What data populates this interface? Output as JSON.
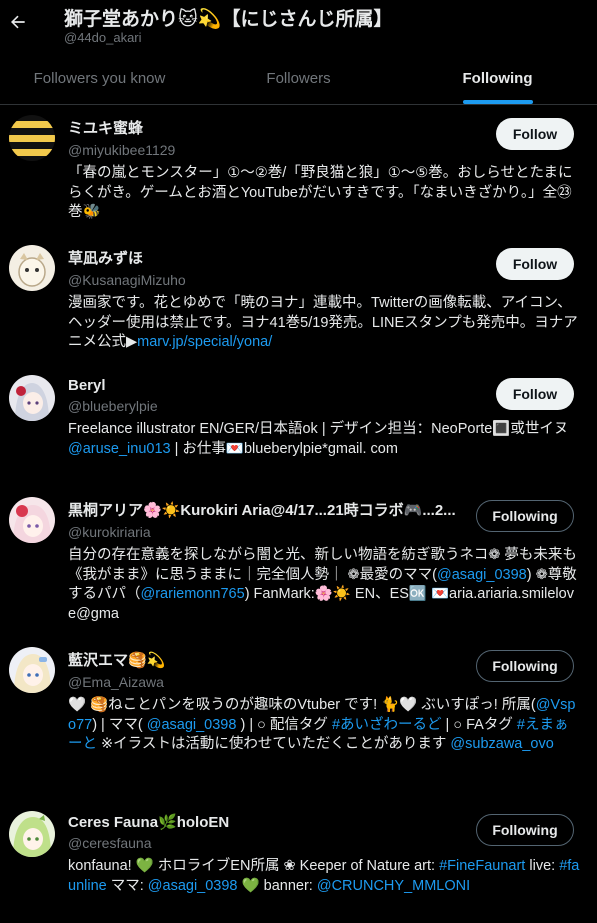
{
  "header": {
    "title": "獅子堂あかり🐱💫【にじさんじ所属】",
    "handle": "@44do_akari",
    "back_icon": "arrow-left-icon"
  },
  "tabs": [
    {
      "label": "Followers you know"
    },
    {
      "label": "Followers"
    },
    {
      "label": "Following",
      "active": true
    }
  ],
  "accent_color": "#1d9bf0",
  "users": [
    {
      "name": "ミユキ蜜蜂",
      "handle": "@miyukibee1129",
      "button": "Follow",
      "bio": "「春の嵐とモンスター」①〜②巻/「野良猫と狼」①〜⑤巻。おしらせとたまにらくがき。ゲームとお酒とYouTubeがだいすきです。「なまいきざかり。」全㉓巻🐝"
    },
    {
      "name": "草凪みずほ",
      "handle": "@KusanagiMizuho",
      "button": "Follow",
      "bio_parts": [
        "漫画家です。花とゆめで「暁のヨナ」連載中。Twitterの画像転載、アイコン、ヘッダー使用は禁止です。ヨナ41巻5/19発売。LINEスタンプも発売中。ヨナアニメ公式▶",
        "marv.jp/special/yona/"
      ]
    },
    {
      "name": "Beryl",
      "handle": "@blueberylpie",
      "button": "Follow",
      "bio_parts": [
        "Freelance illustrator EN/GER/日本語ok | デザイン担当：NeoPorte🔳或世イヌ ",
        "@aruse_inu013",
        " | お仕事💌blueberylpie*gmail. com"
      ]
    },
    {
      "name": "黒桐アリア🌸☀️Kurokiri Aria@4/17...21時コラボ🎮...2...",
      "handle": "@kurokiriaria",
      "button": "Following",
      "bio_parts": [
        "自分の存在意義を探しながら闇と光、新しい物語を紡ぎ歌うネコ❁ 夢も未来も《我がまま》に思うままに｜完全個人勢｜ ❁最愛のママ(",
        "@asagi_0398",
        ") ❁尊敬するパパ（",
        "@rariemonn765",
        ") FanMark:🌸☀️ EN、ES🆗 💌aria.ariaria.smilelove@gma"
      ]
    },
    {
      "name": "藍沢エマ🥞💫",
      "handle": "@Ema_Aizawa",
      "button": "Following",
      "bio_parts": [
        "🤍 🥞ねことパンを吸うのが趣味のVtuber です! 🐈🤍 ぶいすぽっ! 所属(",
        "@Vspo77",
        ") | ママ( ",
        "@asagi_0398",
        " ) | ○ 配信タグ ",
        "#あいざわーるど",
        " | ○ FAタグ ",
        "#えまぁーと",
        " ※イラストは活動に使わせていただくことがあります ",
        "@subzawa_ovo"
      ]
    },
    {
      "name": "Ceres Fauna🌿holoEN",
      "handle": "@ceresfauna",
      "button": "Following",
      "bio_parts": [
        "konfauna! 💚 ホロライブEN所属 ❀ Keeper of Nature art: ",
        "#FineFaunart",
        " live: ",
        "#faunline",
        " ママ: ",
        "@asagi_0398",
        " 💚 banner: ",
        "@CRUNCHY_MMLONI"
      ]
    }
  ]
}
